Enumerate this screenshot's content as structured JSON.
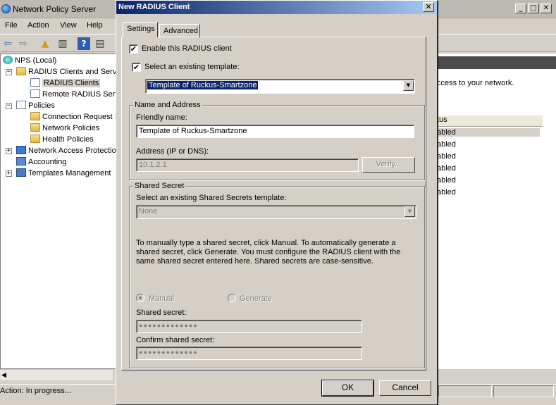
{
  "main_window": {
    "title": "Network Policy Server",
    "menu": [
      "File",
      "Action",
      "View",
      "Help"
    ],
    "tree": [
      {
        "label": "NPS (Local)",
        "icon": "server-icon"
      },
      {
        "label": "RADIUS Clients and Serve",
        "icon": "folder-icon"
      },
      {
        "label": "RADIUS Clients",
        "icon": "clients-icon",
        "selected": true
      },
      {
        "label": "Remote RADIUS Serv",
        "icon": "remote-servers-icon"
      },
      {
        "label": "Policies",
        "icon": "policies-icon"
      },
      {
        "label": "Connection Request I",
        "icon": "folder-icon"
      },
      {
        "label": "Network Policies",
        "icon": "folder-icon"
      },
      {
        "label": "Health Policies",
        "icon": "folder-icon"
      },
      {
        "label": "Network Access Protectio",
        "icon": "nap-icon"
      },
      {
        "label": "Accounting",
        "icon": "accounting-icon"
      },
      {
        "label": "Templates Management",
        "icon": "templates-icon"
      }
    ],
    "right_pane": {
      "text": "ccess to your network.",
      "column_header": "tus",
      "rows": [
        "abled",
        "abled",
        "abled",
        "abled",
        "abled",
        "abled"
      ]
    },
    "status": "Action:  In progress..."
  },
  "dialog": {
    "title": "New RADIUS Client",
    "close_glyph": "✕",
    "tabs": [
      "Settings",
      "Advanced"
    ],
    "enable_client": {
      "label": "Enable this RADIUS client",
      "checked": true
    },
    "use_template": {
      "label": "Select an existing template:",
      "checked": true
    },
    "template_value": "Template of Ruckus-Smartzone",
    "name_address": {
      "title": "Name and Address",
      "friendly_name_label": "Friendly name:",
      "friendly_name_value": "Template of Ruckus-Smartzone",
      "address_label": "Address (IP or DNS):",
      "address_value": "10.1.2.1",
      "verify_label": "Verify..."
    },
    "shared_secret": {
      "title": "Shared Secret",
      "template_label": "Select an existing Shared Secrets template:",
      "template_value": "None",
      "help_text": "To manually type a shared secret, click Manual. To automatically generate a shared secret, click Generate. You must configure the RADIUS client with the same shared secret entered here. Shared secrets are case-sensitive.",
      "manual_label": "Manual",
      "generate_label": "Generate",
      "secret_label": "Shared secret:",
      "secret_value": "●●●●●●●●●●●●●",
      "confirm_label": "Confirm shared secret:",
      "confirm_value": "●●●●●●●●●●●●●"
    },
    "ok_label": "OK",
    "cancel_label": "Cancel"
  }
}
